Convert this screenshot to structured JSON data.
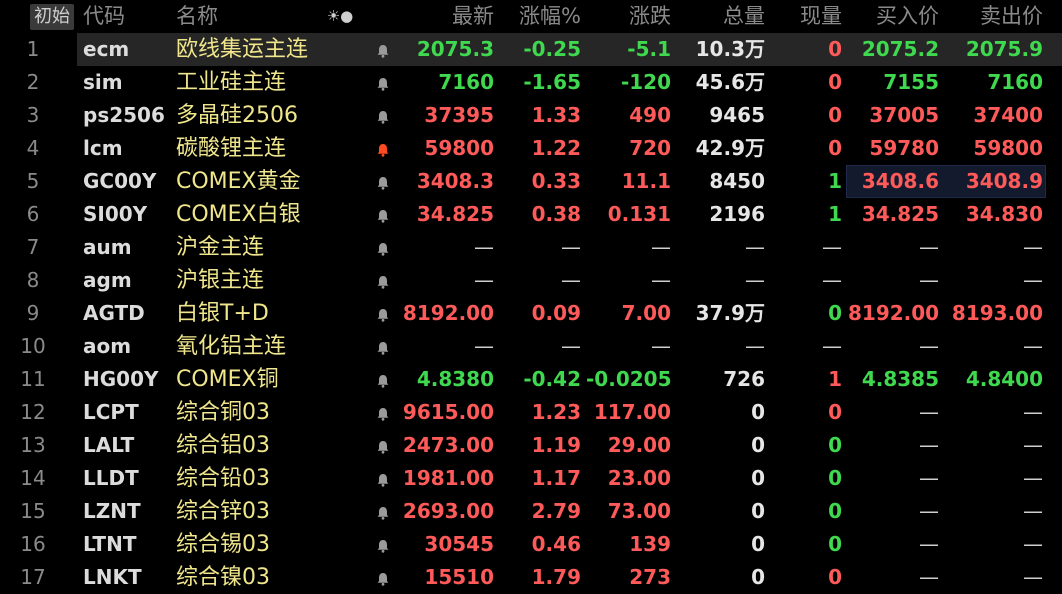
{
  "header": {
    "init_label": "初始",
    "code": "代码",
    "name": "名称",
    "icons": "☀●",
    "last": "最新",
    "pct": "涨幅%",
    "chg": "涨跌",
    "vol": "总量",
    "cur": "现量",
    "bid": "买入价",
    "ask": "卖出价"
  },
  "colors": {
    "up": "#ff5a5a",
    "down": "#3fd84f",
    "name": "#f0e68c",
    "bell_active": "#ff4b1f",
    "bell_inactive": "#9a9a9a"
  },
  "rows": [
    {
      "idx": "1",
      "code": "ecm",
      "name": "欧线集运主连",
      "bell": "inactive",
      "last": "2075.3",
      "pct": "-0.25",
      "chg": "-5.1",
      "vol": "10.3万",
      "cur": "0",
      "bid": "2075.2",
      "ask": "2075.9",
      "dir": "down",
      "cur_dir": "zero-red",
      "selected": true
    },
    {
      "idx": "2",
      "code": "sim",
      "name": "工业硅主连",
      "bell": "inactive",
      "last": "7160",
      "pct": "-1.65",
      "chg": "-120",
      "vol": "45.6万",
      "cur": "0",
      "bid": "7155",
      "ask": "7160",
      "dir": "down",
      "cur_dir": "zero-red"
    },
    {
      "idx": "3",
      "code": "ps2506",
      "name": "多晶硅2506",
      "bell": "inactive",
      "last": "37395",
      "pct": "1.33",
      "chg": "490",
      "vol": "9465",
      "cur": "0",
      "bid": "37005",
      "ask": "37400",
      "dir": "up",
      "cur_dir": "zero-red"
    },
    {
      "idx": "4",
      "code": "lcm",
      "name": "碳酸锂主连",
      "bell": "active",
      "last": "59800",
      "pct": "1.22",
      "chg": "720",
      "vol": "42.9万",
      "cur": "0",
      "bid": "59780",
      "ask": "59800",
      "dir": "up",
      "cur_dir": "zero-red"
    },
    {
      "idx": "5",
      "code": "GC00Y",
      "name": "COMEX黄金",
      "bell": "inactive",
      "last": "3408.3",
      "pct": "0.33",
      "chg": "11.1",
      "vol": "8450",
      "cur": "1",
      "bid": "3408.6",
      "ask": "3408.9",
      "dir": "up",
      "cur_dir": "zero-green",
      "bid_highlight": true
    },
    {
      "idx": "6",
      "code": "SI00Y",
      "name": "COMEX白银",
      "bell": "inactive",
      "last": "34.825",
      "pct": "0.38",
      "chg": "0.131",
      "vol": "2196",
      "cur": "1",
      "bid": "34.825",
      "ask": "34.830",
      "dir": "up",
      "cur_dir": "zero-green"
    },
    {
      "idx": "7",
      "code": "aum",
      "name": "沪金主连",
      "bell": "inactive",
      "last": "—",
      "pct": "—",
      "chg": "—",
      "vol": "—",
      "cur": "—",
      "bid": "—",
      "ask": "—",
      "dir": "dash",
      "cur_dir": "dash"
    },
    {
      "idx": "8",
      "code": "agm",
      "name": "沪银主连",
      "bell": "inactive",
      "last": "—",
      "pct": "—",
      "chg": "—",
      "vol": "—",
      "cur": "—",
      "bid": "—",
      "ask": "—",
      "dir": "dash",
      "cur_dir": "dash"
    },
    {
      "idx": "9",
      "code": "AGTD",
      "name": "白银T+D",
      "bell": "inactive",
      "last": "8192.00",
      "pct": "0.09",
      "chg": "7.00",
      "vol": "37.9万",
      "cur": "0",
      "bid": "8192.00",
      "ask": "8193.00",
      "dir": "up",
      "cur_dir": "zero-green"
    },
    {
      "idx": "10",
      "code": "aom",
      "name": "氧化铝主连",
      "bell": "inactive",
      "last": "—",
      "pct": "—",
      "chg": "—",
      "vol": "—",
      "cur": "—",
      "bid": "—",
      "ask": "—",
      "dir": "dash",
      "cur_dir": "dash"
    },
    {
      "idx": "11",
      "code": "HG00Y",
      "name": "COMEX铜",
      "bell": "inactive",
      "last": "4.8380",
      "pct": "-0.42",
      "chg": "-0.0205",
      "vol": "726",
      "cur": "1",
      "bid": "4.8385",
      "ask": "4.8400",
      "dir": "down",
      "cur_dir": "zero-red"
    },
    {
      "idx": "12",
      "code": "LCPT",
      "name": "综合铜03",
      "bell": "inactive",
      "last": "9615.00",
      "pct": "1.23",
      "chg": "117.00",
      "vol": "0",
      "cur": "0",
      "bid": "—",
      "ask": "—",
      "dir": "up",
      "cur_dir": "zero-red"
    },
    {
      "idx": "13",
      "code": "LALT",
      "name": "综合铝03",
      "bell": "inactive",
      "last": "2473.00",
      "pct": "1.19",
      "chg": "29.00",
      "vol": "0",
      "cur": "0",
      "bid": "—",
      "ask": "—",
      "dir": "up",
      "cur_dir": "zero-green"
    },
    {
      "idx": "14",
      "code": "LLDT",
      "name": "综合铅03",
      "bell": "inactive",
      "last": "1981.00",
      "pct": "1.17",
      "chg": "23.00",
      "vol": "0",
      "cur": "0",
      "bid": "—",
      "ask": "—",
      "dir": "up",
      "cur_dir": "zero-green"
    },
    {
      "idx": "15",
      "code": "LZNT",
      "name": "综合锌03",
      "bell": "inactive",
      "last": "2693.00",
      "pct": "2.79",
      "chg": "73.00",
      "vol": "0",
      "cur": "0",
      "bid": "—",
      "ask": "—",
      "dir": "up",
      "cur_dir": "zero-green"
    },
    {
      "idx": "16",
      "code": "LTNT",
      "name": "综合锡03",
      "bell": "inactive",
      "last": "30545",
      "pct": "0.46",
      "chg": "139",
      "vol": "0",
      "cur": "0",
      "bid": "—",
      "ask": "—",
      "dir": "up",
      "cur_dir": "zero-green"
    },
    {
      "idx": "17",
      "code": "LNKT",
      "name": "综合镍03",
      "bell": "inactive",
      "last": "15510",
      "pct": "1.79",
      "chg": "273",
      "vol": "0",
      "cur": "0",
      "bid": "—",
      "ask": "—",
      "dir": "up",
      "cur_dir": "zero-red"
    }
  ]
}
